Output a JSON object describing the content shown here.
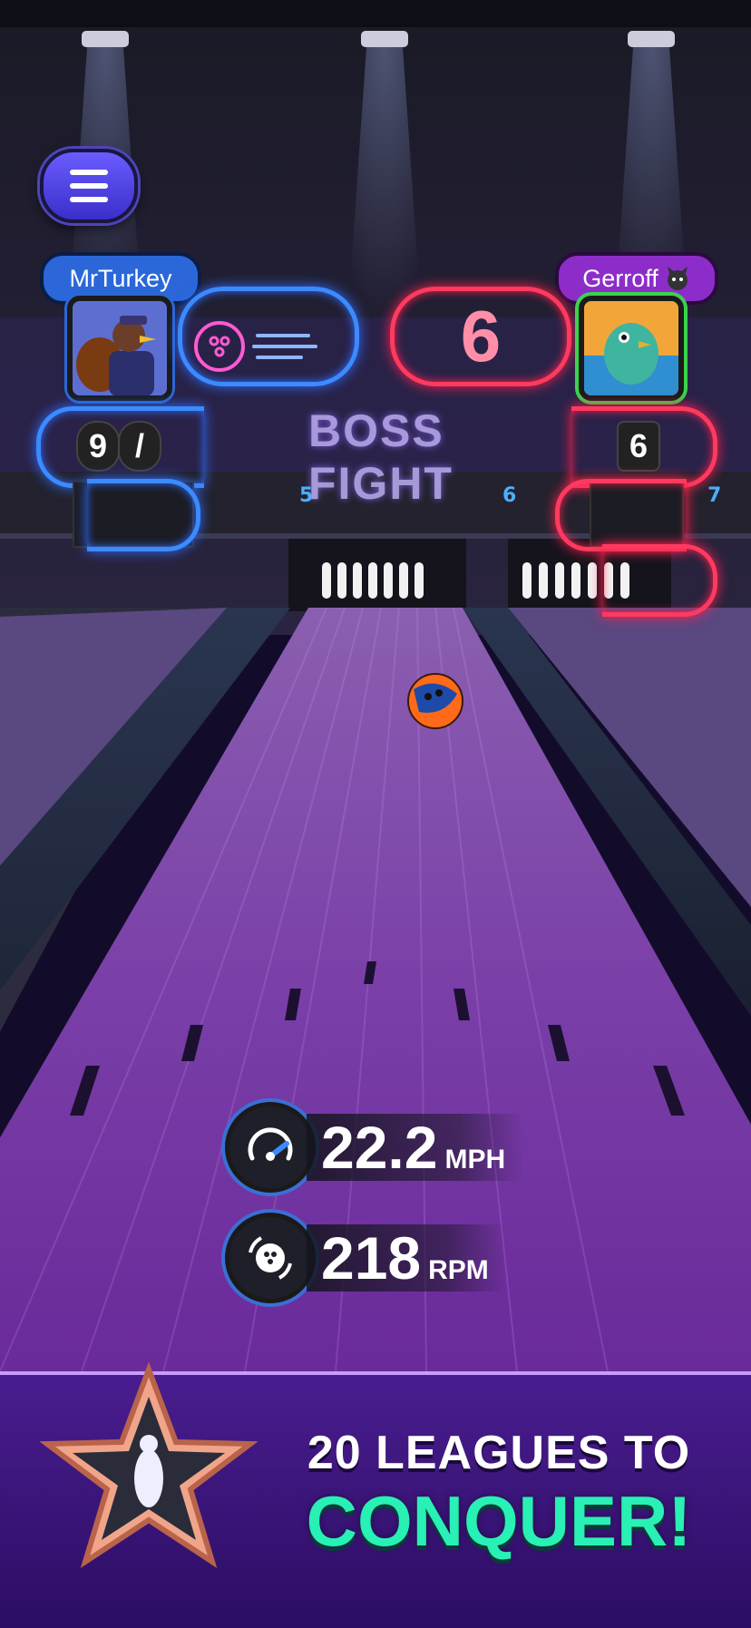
{
  "players": {
    "left": {
      "name": "MrTurkey",
      "frame_score_1": "9",
      "frame_score_2": "/"
    },
    "right": {
      "name": "Gerroff",
      "big_score": "6",
      "frame_score": "6"
    }
  },
  "board": {
    "title": "BOSS FIGHT",
    "lane_numbers": [
      "5",
      "6",
      "7"
    ]
  },
  "stats": {
    "speed": {
      "value": "22.2",
      "unit": "MPH"
    },
    "spin": {
      "value": "218",
      "unit": "RPM"
    }
  },
  "banner": {
    "line1": "20 LEAGUES TO",
    "line2": "CONQUER!"
  },
  "colors": {
    "left_accent": "#3b8bff",
    "right_accent": "#ff3a5e",
    "banner_green": "#29f0b4",
    "banner_bg": "#3b1578"
  }
}
